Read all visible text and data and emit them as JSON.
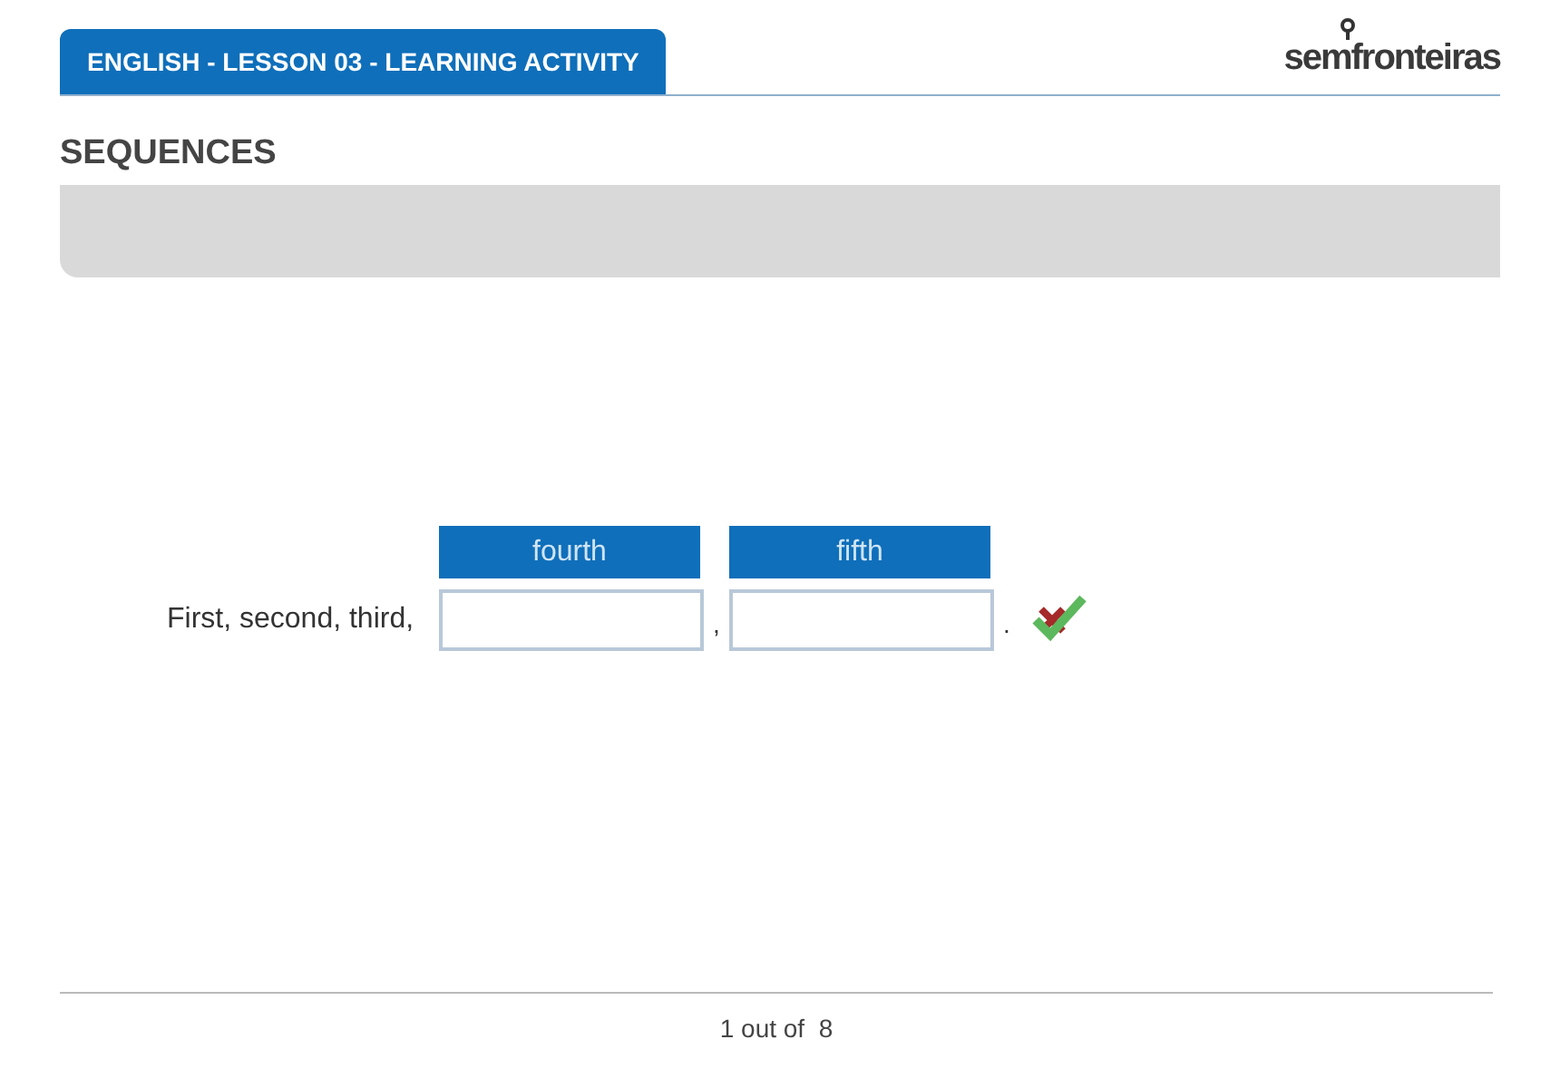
{
  "header": {
    "title": "ENGLISH - LESSON 03 - LEARNING ACTIVITY",
    "logo_start": "sem",
    "logo_end": "fronteiras"
  },
  "section_title": "SEQUENCES",
  "exercise": {
    "prompt": "First, second, third,",
    "words": [
      "fourth",
      "fifth"
    ],
    "blanks": [
      {
        "separator": ","
      },
      {
        "separator": "."
      }
    ]
  },
  "pager": {
    "text": "1 out of  8"
  }
}
